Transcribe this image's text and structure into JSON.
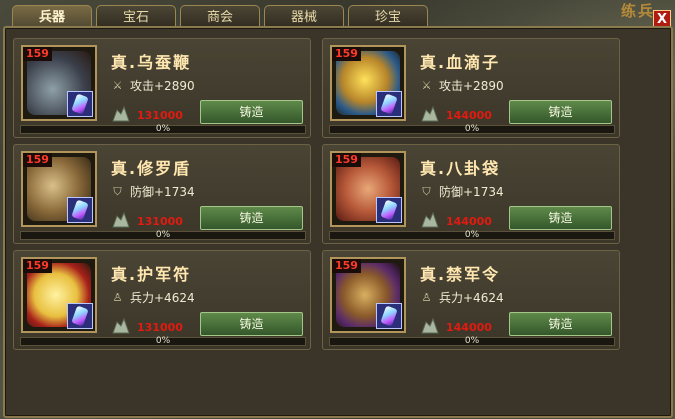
{
  "tabs": [
    {
      "label": "兵器",
      "active": true
    },
    {
      "label": "宝石",
      "active": false
    },
    {
      "label": "商会",
      "active": false
    },
    {
      "label": "器械",
      "active": false
    },
    {
      "label": "珍宝",
      "active": false
    }
  ],
  "close_label": "X",
  "background_text": "练兵",
  "items": [
    {
      "level": "159",
      "name": "真.乌蚕鞭",
      "stat_icon": "sword-icon",
      "stat": "攻击+2890",
      "cost": "131000",
      "forge_label": "铸造",
      "progress": "0%",
      "progress_value": 0
    },
    {
      "level": "159",
      "name": "真.血滴子",
      "stat_icon": "sword-icon",
      "stat": "攻击+2890",
      "cost": "144000",
      "forge_label": "铸造",
      "progress": "0%",
      "progress_value": 0
    },
    {
      "level": "159",
      "name": "真.修罗盾",
      "stat_icon": "shield-icon",
      "stat": "防御+1734",
      "cost": "131000",
      "forge_label": "铸造",
      "progress": "0%",
      "progress_value": 0
    },
    {
      "level": "159",
      "name": "真.八卦袋",
      "stat_icon": "shield-icon",
      "stat": "防御+1734",
      "cost": "144000",
      "forge_label": "铸造",
      "progress": "0%",
      "progress_value": 0
    },
    {
      "level": "159",
      "name": "真.护军符",
      "stat_icon": "soldier-icon",
      "stat": "兵力+4624",
      "cost": "131000",
      "forge_label": "铸造",
      "progress": "0%",
      "progress_value": 0
    },
    {
      "level": "159",
      "name": "真.禁军令",
      "stat_icon": "soldier-icon",
      "stat": "兵力+4624",
      "cost": "144000",
      "forge_label": "铸造",
      "progress": "0%",
      "progress_value": 0
    }
  ],
  "colors": {
    "cost": "#e21a10",
    "level": "#ff3a2a",
    "forge_button": "#4a7a3a",
    "name": "#ffe7b0"
  }
}
